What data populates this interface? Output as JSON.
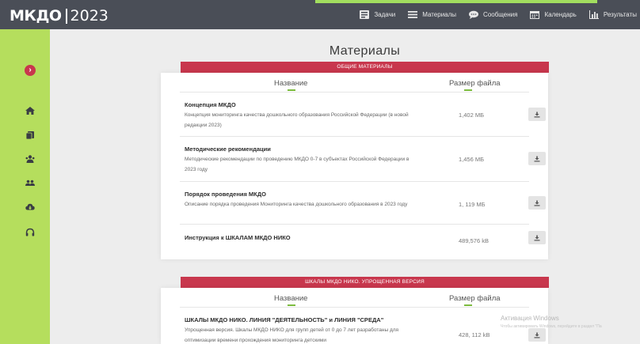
{
  "header": {
    "logo_text": "МКДО",
    "logo_year": "2023",
    "nav": [
      {
        "label": "Задачи",
        "icon": "tasks-icon"
      },
      {
        "label": "Материалы",
        "icon": "list-icon"
      },
      {
        "label": "Сообщения",
        "icon": "chat-icon"
      },
      {
        "label": "Календарь",
        "icon": "calendar-icon"
      },
      {
        "label": "Результаты",
        "icon": "chart-icon"
      }
    ]
  },
  "sidebar": {
    "toggle_icon": "chevron-right-icon",
    "items": [
      "home-icon",
      "book-icon",
      "users-icon",
      "group-icon",
      "cloud-download-icon",
      "headset-icon"
    ]
  },
  "page": {
    "title": "Материалы"
  },
  "section1": {
    "banner": "ОБЩИЕ МАТЕРИАЛЫ",
    "col_name": "Название",
    "col_size": "Размер файла",
    "rows": [
      {
        "title": "Концепция МКДО",
        "desc": "Концепция мониторинга качества дошкольного образования Российской Федерации (в новой редакции 2023)",
        "size": "1,402 МБ"
      },
      {
        "title": "Методические рекомендации",
        "desc": "Методические рекомендации по проведению МКДО 0-7 в субъектах Российской Федерации в 2023 году",
        "size": "1,456 МБ"
      },
      {
        "title": "Порядок проведения МКДО",
        "desc": "Описание порядка проведения Мониторинга качества дошкольного образования в 2023 году",
        "size": "1, 119 МБ"
      },
      {
        "title": "Инструкция к ШКАЛАМ МКДО НИКО",
        "desc": "",
        "size": "489,576 kB"
      }
    ]
  },
  "section2": {
    "banner": "ШКАЛЫ МКДО НИКО. УПРОЩЕННАЯ ВЕРСИЯ",
    "col_name": "Название",
    "col_size": "Размер файла",
    "rows": [
      {
        "title": "ШКАЛЫ МКДО НИКО. ЛИНИЯ \"ДЕЯТЕЛЬНОСТЬ\" и ЛИНИЯ \"СРЕДА\"",
        "desc": "Упрощенная версия. Шкалы МКДО НИКО для групп детей от 0 до 7 лет разработаны для оптимизации времени прохождения мониторинга детскими",
        "size": "428, 112 kB"
      }
    ]
  },
  "watermark": {
    "line1": "Активация Windows",
    "line2": "Чтобы активировать Windows, перейдите в раздел \"Па"
  },
  "colors": {
    "topbar": "#4a4e57",
    "sidebar": "#b5de5d",
    "accent_red": "#c8374d",
    "accent_green": "#7cbb3e"
  }
}
